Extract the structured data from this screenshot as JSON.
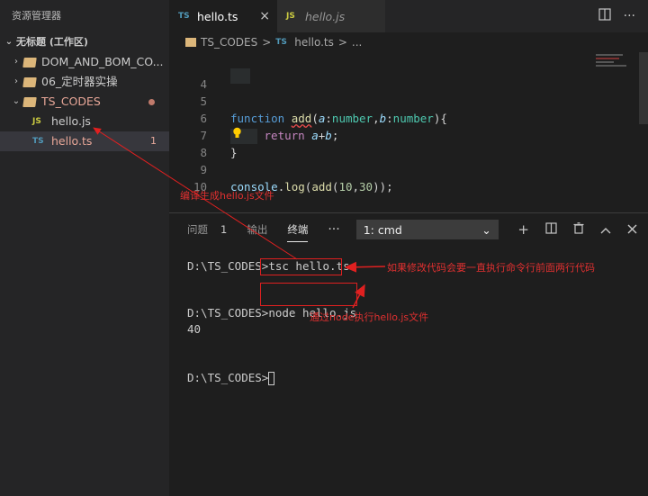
{
  "sidebar": {
    "title": "资源管理器",
    "workspace": "无标题 (工作区)",
    "items": [
      {
        "label": "DOM_AND_BOM_CO..."
      },
      {
        "label": "06_定时器实操"
      },
      {
        "label": "TS_CODES"
      },
      {
        "label": "hello.js",
        "badge": "JS"
      },
      {
        "label": "hello.ts",
        "badge": "TS",
        "count": "1"
      }
    ]
  },
  "tabs": [
    {
      "badge": "TS",
      "label": "hello.ts",
      "close": "×"
    },
    {
      "badge": "JS",
      "label": "hello.js"
    }
  ],
  "breadcrumb": {
    "folder": "TS_CODES",
    "sep1": ">",
    "badge": "TS",
    "file": "hello.ts",
    "sep2": ">",
    "more": "..."
  },
  "editor": {
    "line_numbers": [
      "4",
      "5",
      "6",
      "7",
      "8",
      "9",
      "10"
    ],
    "l5": {
      "kw": "function",
      "fn": "add",
      "p1": "a",
      "t1": "number",
      "p2": "b",
      "t2": "number"
    },
    "l6": {
      "kw": "return",
      "a": "a",
      "b": "b"
    },
    "l7": "}",
    "l9": {
      "obj": "console",
      "method": "log",
      "fn": "add",
      "n1": "10",
      "n2": "30"
    }
  },
  "panel": {
    "tabs": [
      {
        "label": "问题",
        "count": "1"
      },
      {
        "label": "输出"
      },
      {
        "label": "终端"
      }
    ],
    "more": "···",
    "select": {
      "value": "1: cmd"
    }
  },
  "terminal": {
    "lines": [
      {
        "prompt": "D:\\TS_CODES>",
        "cmd": "tsc hello.ts"
      },
      {
        "prompt": "D:\\TS_CODES>",
        "cmd": "node hello.js"
      },
      {
        "output": "40"
      },
      {
        "prompt": "D:\\TS_CODES>",
        "cmd": ""
      }
    ]
  },
  "annotations": {
    "compile": "编译生成hello.js文件",
    "rerun": "如果修改代码会要一直执行命令行前面两行代码",
    "node": "通过node执行hello.js文件"
  },
  "colors": {
    "annotation": "#e02020",
    "folder": "#dcb67a",
    "ts": "#519aba",
    "js": "#cbcb41"
  }
}
